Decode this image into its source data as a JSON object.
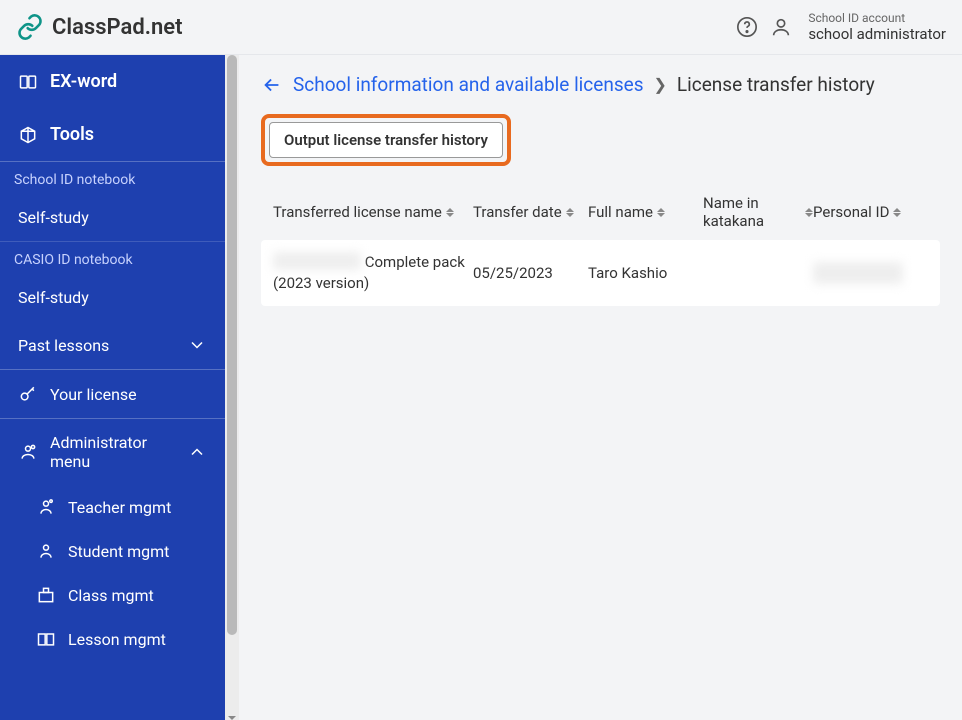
{
  "brand": {
    "name": "ClassPad.net"
  },
  "account": {
    "small": "School ID account",
    "role": "school administrator"
  },
  "sidebar": {
    "exword": "EX-word",
    "tools": "Tools",
    "school_notebook": "School ID notebook",
    "self_study": "Self-study",
    "casio_notebook": "CASIO ID notebook",
    "self_study2": "Self-study",
    "past_lessons": "Past lessons",
    "your_license": "Your license",
    "admin_menu": "Administrator menu",
    "teacher_mgmt": "Teacher mgmt",
    "student_mgmt": "Student mgmt",
    "class_mgmt": "Class mgmt",
    "lesson_mgmt": "Lesson mgmt"
  },
  "breadcrumb": {
    "link": "School information and available licenses",
    "current": "License transfer history"
  },
  "button": {
    "output": "Output license transfer history"
  },
  "table": {
    "headers": {
      "license": "Transferred license name",
      "date": "Transfer date",
      "name": "Full name",
      "katakana": "Name in katakana",
      "pid": "Personal ID"
    },
    "row": {
      "license_suffix": " Complete pack (2023 version)",
      "date": "05/25/2023",
      "name": "Taro Kashio"
    }
  }
}
